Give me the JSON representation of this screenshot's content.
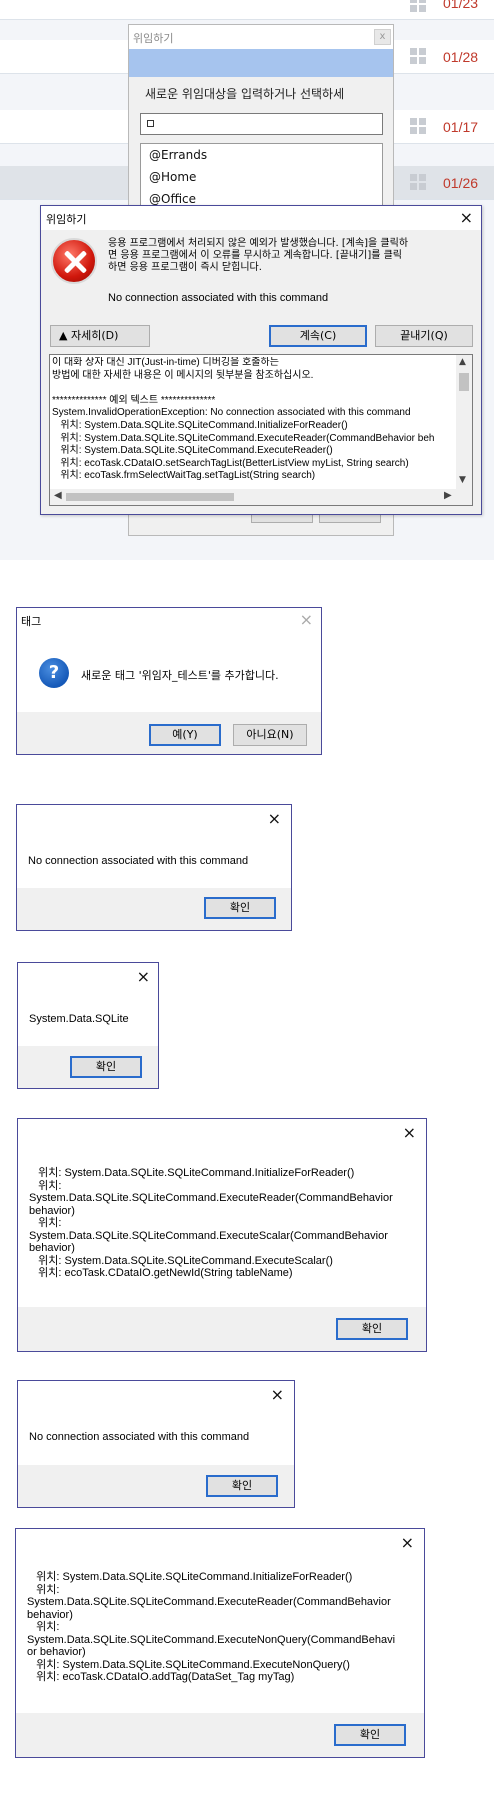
{
  "task_list": {
    "rows": [
      {
        "date": "01/23"
      },
      {
        "date": "01/28"
      },
      {
        "date": "01/17"
      },
      {
        "date": "01/26"
      }
    ]
  },
  "delegate_dialog": {
    "title": "위임하기",
    "close_label": "x",
    "prompt": "새로운 위임대상을 입력하거나 선택하세",
    "items": [
      "@Errands",
      "@Home",
      "@Office"
    ]
  },
  "error_dialog": {
    "title": "위임하기",
    "message": "응용 프로그램에서 처리되지 않은 예외가 발생했습니다. [계속]을 클릭하\n면 응용 프로그램에서 이 오류를 무시하고 계속합니다. [끝내기]를 클릭\n하면 응용 프로그램이 즉시 닫힙니다.",
    "error_text": "No connection associated with this command",
    "details_button": "▲  자세히(D)",
    "continue_button": "계속(C)",
    "quit_button": "끝내기(Q)",
    "details_text": "이 대화 상자 대신 JIT(Just-in-time) 디버깅을 호출하는\n방법에 대한 자세한 내용은 이 메시지의 뒷부분을 참조하십시오.\n\n************** 예외 텍스트 **************\nSystem.InvalidOperationException: No connection associated with this command\n   위치: System.Data.SQLite.SQLiteCommand.InitializeForReader()\n   위치: System.Data.SQLite.SQLiteCommand.ExecuteReader(CommandBehavior beh\n   위치: System.Data.SQLite.SQLiteCommand.ExecuteReader()\n   위치: ecoTask.CDataIO.setSearchTagList(BetterListView myList, String search)\n   위치: ecoTask.frmSelectWaitTag.setTagList(String search)"
  },
  "tag_dialog": {
    "title": "태그",
    "message": "새로운 태그 '위임자_테스트'를 추가합니다.",
    "yes_button": "예(Y)",
    "no_button": "아니요(N)"
  },
  "msg1": {
    "text": "No connection associated with this command",
    "ok_button": "확인"
  },
  "msg2": {
    "text": "System.Data.SQLite",
    "ok_button": "확인"
  },
  "msg3": {
    "text": "   위치: System.Data.SQLite.SQLiteCommand.InitializeForReader()\n   위치:\nSystem.Data.SQLite.SQLiteCommand.ExecuteReader(CommandBehavior\nbehavior)\n   위치:\nSystem.Data.SQLite.SQLiteCommand.ExecuteScalar(CommandBehavior\nbehavior)\n   위치: System.Data.SQLite.SQLiteCommand.ExecuteScalar()\n   위치: ecoTask.CDataIO.getNewId(String tableName)",
    "ok_button": "확인"
  },
  "msg4": {
    "text": "No connection associated with this command",
    "ok_button": "확인"
  },
  "msg5": {
    "text": "   위치: System.Data.SQLite.SQLiteCommand.InitializeForReader()\n   위치:\nSystem.Data.SQLite.SQLiteCommand.ExecuteReader(CommandBehavior\nbehavior)\n   위치:\nSystem.Data.SQLite.SQLiteCommand.ExecuteNonQuery(CommandBehavi\nor behavior)\n   위치: System.Data.SQLite.SQLiteCommand.ExecuteNonQuery()\n   위치: ecoTask.CDataIO.addTag(DataSet_Tag myTag)",
    "ok_button": "확인"
  },
  "icons": {
    "close": "×",
    "error": "error-icon",
    "question": "?"
  },
  "colors": {
    "accent_blue": "#2a6ccc",
    "date_red": "#c0392b",
    "dialog_border": "#4a4a9a",
    "band_blue": "#a6c4ee"
  }
}
